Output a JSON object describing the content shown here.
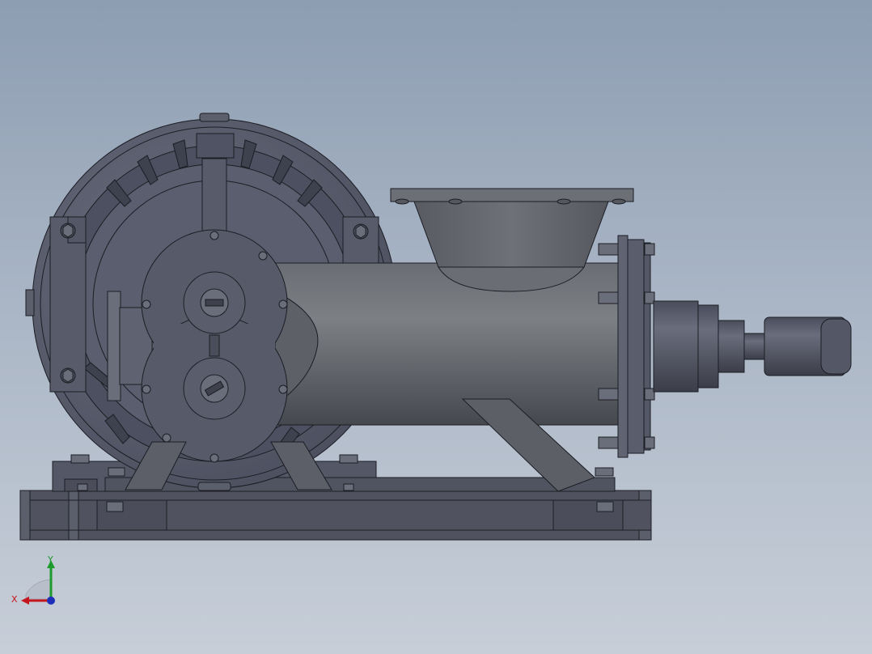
{
  "viewport": {
    "background_top": "#8d9db2",
    "background_bottom": "#c7ced8"
  },
  "model": {
    "body_color": "#4e5160",
    "housing_color": "#5a5d6c",
    "shadow_color": "#3b3d48"
  },
  "triad": {
    "x_label": "X",
    "y_label": "Y",
    "x_color": "#c4161c",
    "y_color": "#1c9a2c",
    "z_color": "#1d2fb8"
  }
}
